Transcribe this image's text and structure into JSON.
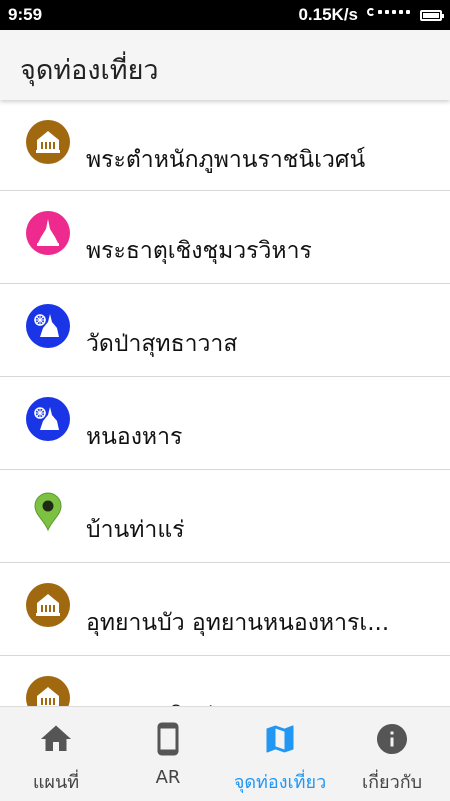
{
  "status_bar": {
    "time": "9:59",
    "network_speed": "0.15K/s",
    "battery_level": 0.9
  },
  "header": {
    "title": "จุดท่องเที่ยว"
  },
  "places": [
    {
      "name": "พระตำหนักภูพานราชนิเวศน์",
      "icon": "royal-palace-icon",
      "icon_color": "#a0680f"
    },
    {
      "name": "พระธาตุเชิงชุมวรวิหาร",
      "icon": "stupa-icon",
      "icon_color": "#ee2a8f"
    },
    {
      "name": "วัดป่าสุทธาวาส",
      "icon": "dharma-wheel-stupa-icon",
      "icon_color": "#1a35e6"
    },
    {
      "name": "หนองหาร",
      "icon": "dharma-wheel-stupa-icon",
      "icon_color": "#1a35e6"
    },
    {
      "name": "บ้านท่าแร่",
      "icon": "map-pin-icon",
      "icon_color": "#7cc142"
    },
    {
      "name": "อุทยานบัว อุทยานหนองหารเ...",
      "icon": "royal-palace-icon",
      "icon_color": "#a0680f"
    },
    {
      "name": "ธรรมชาติแห่งความสุข ...",
      "icon": "royal-palace-icon",
      "icon_color": "#a0680f"
    }
  ],
  "bottom_nav": {
    "tabs": [
      {
        "label": "แผนที่",
        "icon": "home-icon"
      },
      {
        "label": "AR",
        "icon": "phone-icon"
      },
      {
        "label": "จุดท่องเที่ยว",
        "icon": "map-icon"
      },
      {
        "label": "เกี่ยวกับ",
        "icon": "info-icon"
      }
    ],
    "active_color": "#2196f3",
    "inactive_color": "#555555"
  }
}
